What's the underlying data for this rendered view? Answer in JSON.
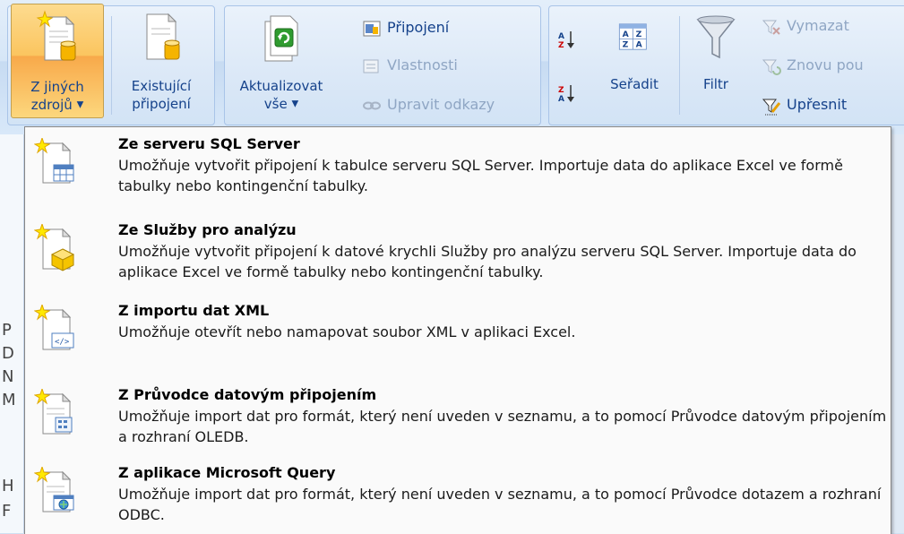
{
  "ribbon": {
    "from_other_sources": {
      "line1": "Z jiných",
      "line2": "zdrojů"
    },
    "existing_connections": {
      "line1": "Existující",
      "line2": "připojení"
    },
    "refresh_all": {
      "line1": "Aktualizovat",
      "line2": "vše"
    },
    "connections": "Připojení",
    "properties": "Vlastnosti",
    "edit_links": "Upravit odkazy",
    "sort": "Seřadit",
    "filter": "Filtr",
    "clear": "Vymazat",
    "reapply": "Znovu pou",
    "advanced": "Upřesnit"
  },
  "sheet": {
    "row_letters": [
      "P",
      "D",
      "N",
      "M",
      "H",
      "F"
    ]
  },
  "menu": {
    "items": [
      {
        "title": "Ze serveru SQL Server",
        "desc": "Umožňuje vytvořit připojení k tabulce serveru SQL Server. Importuje data do aplikace Excel ve formě tabulky nebo kontingenční tabulky.",
        "icon": "sql-server-icon"
      },
      {
        "title": "Ze Služby pro analýzu",
        "desc": "Umožňuje vytvořit připojení k datové krychli Služby pro analýzu serveru SQL Server. Importuje data do aplikace Excel ve formě tabulky nebo kontingenční tabulky.",
        "icon": "analysis-services-icon"
      },
      {
        "title": "Z importu dat XML",
        "desc": "Umožňuje otevřít nebo namapovat soubor XML v aplikaci Excel.",
        "icon": "xml-icon"
      },
      {
        "title": "Z Průvodce datovým připojením",
        "desc": "Umožňuje import dat pro formát, který není uveden v seznamu, a to pomocí Průvodce datovým připojením a rozhraní OLEDB.",
        "icon": "data-connection-wizard-icon"
      },
      {
        "title": "Z aplikace Microsoft Query",
        "desc": "Umožňuje import dat pro formát, který není uveden v seznamu, a to pomocí Průvodce dotazem a rozhraní ODBC.",
        "icon": "microsoft-query-icon"
      }
    ]
  },
  "colors": {
    "ribbon_text": "#15428b",
    "active_button": "#fbc55f",
    "menu_bg": "#fafafa"
  }
}
